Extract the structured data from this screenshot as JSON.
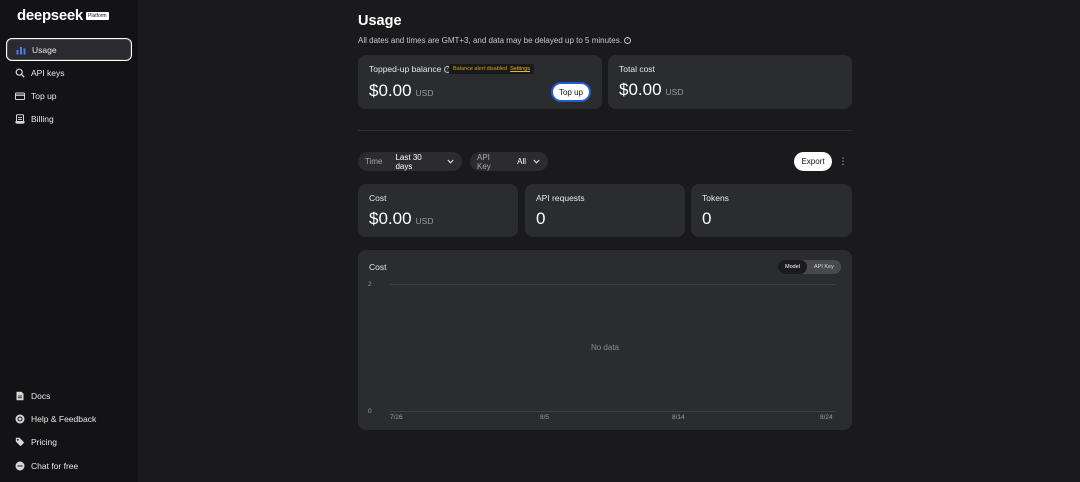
{
  "brand": {
    "name": "deepseek",
    "badge": "Platform"
  },
  "sidebar": {
    "top_items": [
      {
        "label": "Usage",
        "icon": "bar-chart-icon",
        "active": true
      },
      {
        "label": "API keys",
        "icon": "search-icon"
      },
      {
        "label": "Top up",
        "icon": "card-icon"
      },
      {
        "label": "Billing",
        "icon": "receipt-icon"
      }
    ],
    "bottom_items": [
      {
        "label": "Docs",
        "icon": "doc-icon"
      },
      {
        "label": "Help & Feedback",
        "icon": "help-icon"
      },
      {
        "label": "Pricing",
        "icon": "tag-icon"
      },
      {
        "label": "Chat for free",
        "icon": "chat-icon"
      }
    ]
  },
  "page": {
    "title": "Usage",
    "subtitle": "All dates and times are GMT+3, and data may be delayed up to 5 minutes."
  },
  "balance": {
    "label": "Topped-up balance",
    "alert": "Balance alert disabled",
    "alert_link": "Settings",
    "value": "$0.00",
    "unit": "USD",
    "button": "Top up"
  },
  "total_cost": {
    "label": "Total cost",
    "value": "$0.00",
    "unit": "USD"
  },
  "filters": {
    "time_label": "Time",
    "time_value": "Last 30 days",
    "apikey_label": "API Key",
    "apikey_value": "All",
    "export": "Export"
  },
  "stats": {
    "cost": {
      "label": "Cost",
      "value": "$0.00",
      "unit": "USD"
    },
    "requests": {
      "label": "API requests",
      "value": "0"
    },
    "tokens": {
      "label": "Tokens",
      "value": "0"
    }
  },
  "chart_panel": {
    "title": "Cost",
    "toggle": [
      "Model",
      "API Key"
    ],
    "active_toggle": "Model",
    "empty_text": "No data"
  },
  "chart_data": {
    "type": "bar",
    "title": "Cost",
    "categories": [
      "7/26",
      "8/5",
      "8/14",
      "8/24"
    ],
    "values": [],
    "yticks": [
      "2",
      "0"
    ],
    "ylim": [
      0,
      2
    ],
    "grid": true
  },
  "colors": {
    "accent_ring": "#1f5cd6",
    "alert_text": "#d4a017",
    "card_bg": "#2b2c30"
  }
}
